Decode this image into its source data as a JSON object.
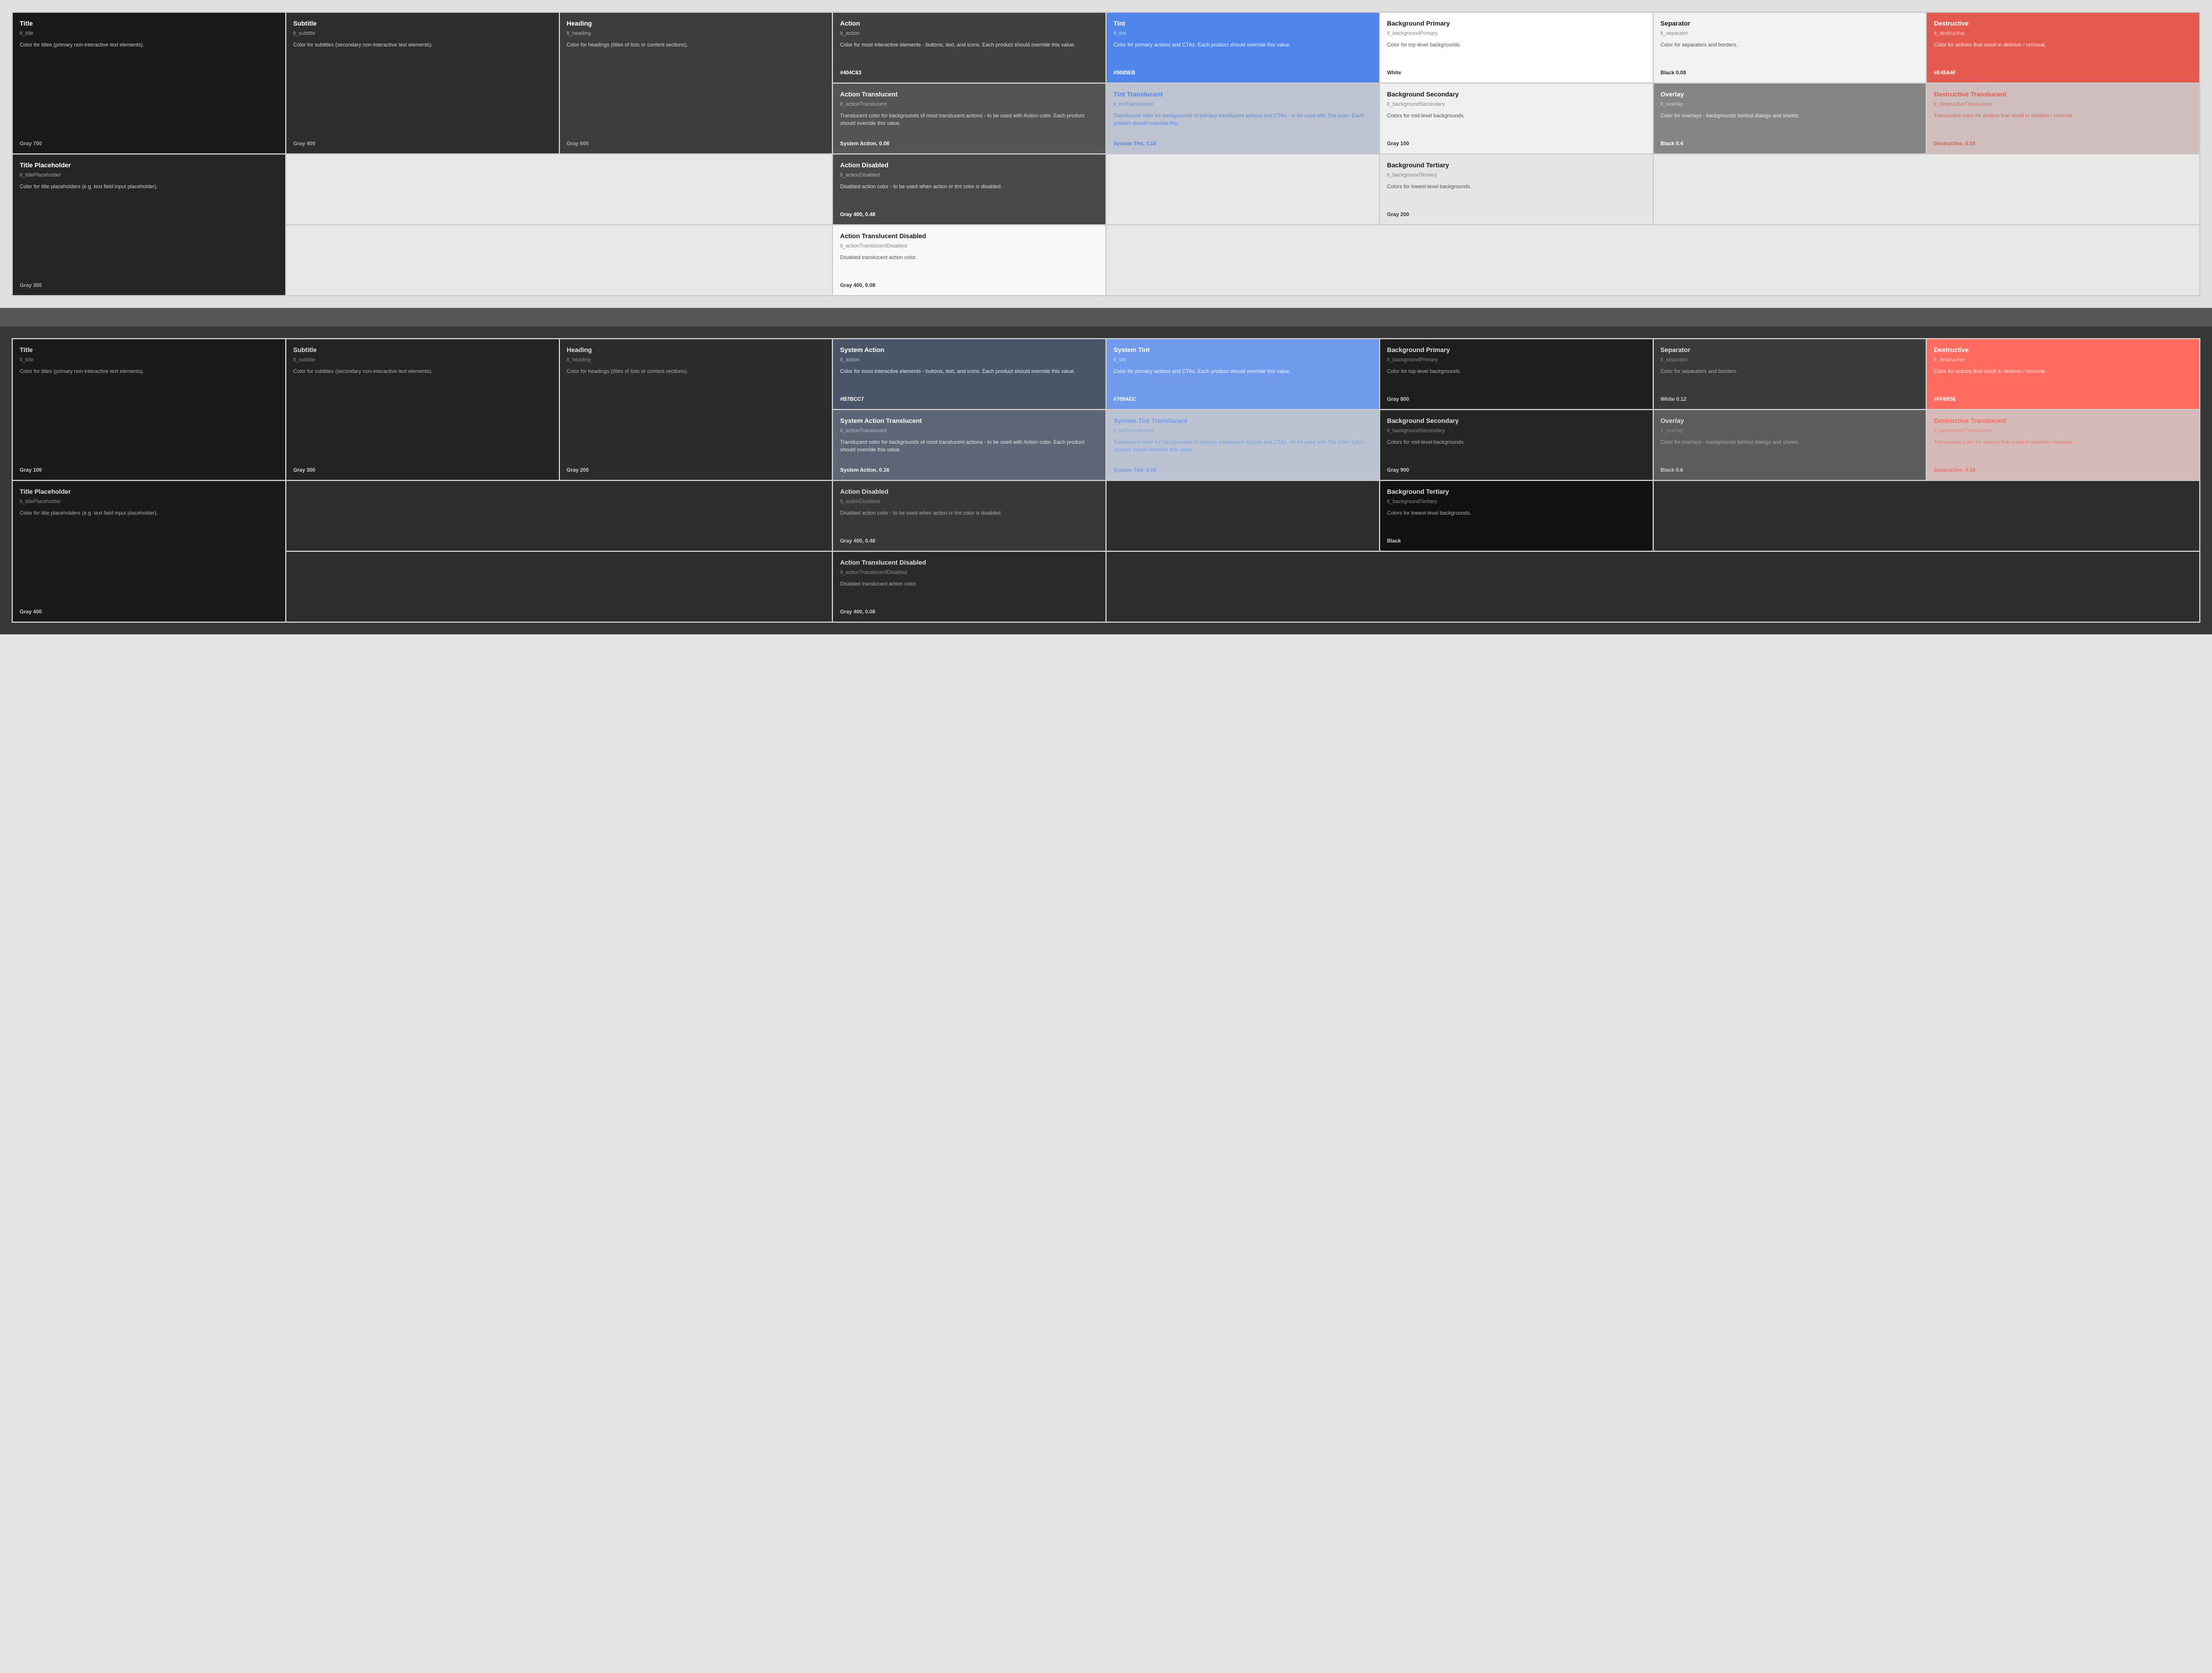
{
  "light": {
    "section_bg": "#e8e8e8",
    "cards": [
      {
        "id": "title",
        "title": "Title",
        "token": "lt_title",
        "desc": "Color for titles (primary non-interactive text elements).",
        "value": "Gray 700",
        "bg_class": "lt-title",
        "title_color": "#ffffff",
        "token_color": "rgba(255,255,255,0.6)",
        "desc_color": "rgba(255,255,255,0.75)",
        "value_color": "#cccccc"
      },
      {
        "id": "subtitle",
        "title": "Subtitle",
        "token": "lt_subtitle",
        "desc": "Color for subtitles (secondary non-interactive text elements).",
        "value": "Gray 400",
        "bg_class": "lt-subtitle",
        "title_color": "#ffffff",
        "token_color": "rgba(255,255,255,0.6)",
        "desc_color": "rgba(255,255,255,0.75)",
        "value_color": "#cccccc"
      },
      {
        "id": "heading",
        "title": "Heading",
        "token": "lt_heading",
        "desc": "Color for headings (titles of lists or content sections).",
        "value": "Gray 600",
        "bg_class": "lt-heading",
        "title_color": "#ffffff",
        "token_color": "rgba(255,255,255,0.6)",
        "desc_color": "rgba(255,255,255,0.75)",
        "value_color": "#cccccc"
      },
      {
        "id": "action",
        "title": "Action",
        "token": "lt_action",
        "desc": "Color for most interactive elements - buttons, text, and icons. Each product should override this value.",
        "value": "#404C63",
        "bg_class": "lt-action",
        "title_color": "#ffffff",
        "token_color": "rgba(255,255,255,0.6)",
        "desc_color": "rgba(255,255,255,0.8)",
        "value_color": "#ffffff"
      },
      {
        "id": "tint",
        "title": "Tint",
        "token": "lt_tint",
        "desc": "Color for primary actions and CTAs. Each product should override this value.",
        "value": "#5085EB",
        "bg_class": "lt-tint",
        "title_color": "#ffffff",
        "token_color": "rgba(255,255,255,0.7)",
        "desc_color": "rgba(255,255,255,0.9)",
        "value_color": "#ffffff"
      },
      {
        "id": "bg-primary",
        "title": "Background Primary",
        "token": "lt_backgroundPrimary",
        "desc": "Color for top-level backgrounds.",
        "value": "White",
        "bg_class": "lt-bg-primary",
        "title_color": "#1a1a1a",
        "token_color": "#888",
        "desc_color": "#555",
        "value_color": "#333"
      },
      {
        "id": "separator",
        "title": "Separator",
        "token": "lt_separator",
        "desc": "Color for separators and borders.",
        "value": "Black 0.08",
        "bg_class": "lt-separator",
        "title_color": "#1a1a1a",
        "token_color": "#888",
        "desc_color": "#555",
        "value_color": "#333"
      },
      {
        "id": "destructive",
        "title": "Destructive",
        "token": "lt_destructive",
        "desc": "Color for actions that result in deletion / removal.",
        "value": "#E45A4F",
        "bg_class": "lt-destructive",
        "title_color": "#ffffff",
        "token_color": "rgba(255,255,255,0.7)",
        "desc_color": "rgba(255,255,255,0.9)",
        "value_color": "#ffffff"
      },
      {
        "id": "title-placeholder",
        "title": "Title Placeholder",
        "token": "lt_titlePlaceholder",
        "desc": "Color for title placeholders (e.g. text field input placeholder).",
        "value": "Gray 300",
        "bg_class": "lt-title-ph",
        "title_color": "#ffffff",
        "token_color": "rgba(255,255,255,0.6)",
        "desc_color": "rgba(255,255,255,0.75)",
        "value_color": "#cccccc",
        "row_span": 2
      },
      {
        "id": "action-translucent",
        "title": "Action Translucent",
        "token": "lt_actionTranslucent",
        "desc": "Translucent color for backgrounds of most translucent actions - to be used with Action color. Each product should override this value.",
        "value": "System Action, 0.08",
        "bg_class": "lt-action",
        "title_color": "#ffffff",
        "token_color": "rgba(255,255,255,0.6)",
        "desc_color": "rgba(255,255,255,0.8)",
        "value_color": "#ffffff"
      },
      {
        "id": "tint-translucent",
        "title": "Tint Translucent",
        "token": "lt_tintTranslucent",
        "desc": "Translucent color for backgrounds of primary translucent actions and CTAs - to be used with Tint color. Each product should override this.",
        "value": "System Tint, 0.16",
        "bg_class": "lt-tint-trans",
        "title_color": "#5085EB",
        "token_color": "#5085EB",
        "desc_color": "#5085EB",
        "value_color": "#5085EB"
      },
      {
        "id": "bg-secondary",
        "title": "Background Secondary",
        "token": "lt_backgroundSecondary",
        "desc": "Colors for mid-level backgrounds.",
        "value": "Gray 100",
        "bg_class": "lt-bg-secondary",
        "title_color": "#1a1a1a",
        "token_color": "#888",
        "desc_color": "#555",
        "value_color": "#333"
      },
      {
        "id": "overlay",
        "title": "Overlay",
        "token": "lt_overlay",
        "desc": "Color for overlays - backgrounds behind dialogs and sheets.",
        "value": "Black 0.4",
        "bg_class": "lt-overlay",
        "title_color": "#ffffff",
        "token_color": "rgba(255,255,255,0.6)",
        "desc_color": "rgba(255,255,255,0.8)",
        "value_color": "#ffffff"
      },
      {
        "id": "destructive-translucent",
        "title": "Destructive Translucent",
        "token": "lt_destructiveTranslucent",
        "desc": "Translucent color for actions that result in deletion / removal.",
        "value": "Destructive, 0.16",
        "bg_class": "lt-destructive-trans",
        "title_color": "#E45A4F",
        "token_color": "#E45A4F",
        "desc_color": "#E45A4F",
        "value_color": "#E45A4F"
      },
      {
        "id": "action-disabled",
        "title": "Action Disabled",
        "token": "lt_actionDisabled",
        "desc": "Disabled action color - to be used when action or tint color is disabled.",
        "value": "Gray 400, 0.48",
        "bg_class": "lt-action-disabled",
        "title_color": "#ffffff",
        "token_color": "rgba(255,255,255,0.6)",
        "desc_color": "rgba(255,255,255,0.8)",
        "value_color": "#ffffff"
      },
      {
        "id": "bg-tertiary",
        "title": "Background Tertiary",
        "token": "lt_backgroundTertiary",
        "desc": "Colors for lowest-level backgrounds.",
        "value": "Gray 200",
        "bg_class": "lt-bg-tertiary",
        "title_color": "#1a1a1a",
        "token_color": "#888",
        "desc_color": "#555",
        "value_color": "#333"
      },
      {
        "id": "action-trans-disabled",
        "title": "Action Translucent Disabled",
        "token": "lt_actionTranslucentDisabled",
        "desc": "Disabled translucent action color.",
        "value": "Gray 400, 0.08",
        "bg_class": "lt-action-trans-disabled",
        "title_color": "#1a1a1a",
        "token_color": "#888",
        "desc_color": "#555",
        "value_color": "#333"
      }
    ]
  },
  "dark": {
    "section_bg": "#2a2a2a",
    "cards": [
      {
        "id": "dk-title",
        "title": "Title",
        "token": "lt_title",
        "desc": "Color for titles (primary non-interactive text elements).",
        "value": "Gray 100",
        "bg_class": "dk-title",
        "title_color": "#dddddd",
        "token_color": "#888888",
        "desc_color": "#aaaaaa",
        "value_color": "#cccccc"
      },
      {
        "id": "dk-subtitle",
        "title": "Subtitle",
        "token": "lt_subtitle",
        "desc": "Color for subtitles (secondary non-interactive text elements).",
        "value": "Gray 300",
        "bg_class": "dk-subtitle",
        "title_color": "#dddddd",
        "token_color": "#888888",
        "desc_color": "#aaaaaa",
        "value_color": "#cccccc"
      },
      {
        "id": "dk-heading",
        "title": "Heading",
        "token": "lt_heading",
        "desc": "Color for headings (titles of lists or content sections).",
        "value": "Gray 200",
        "bg_class": "dk-heading",
        "title_color": "#dddddd",
        "token_color": "#888888",
        "desc_color": "#aaaaaa",
        "value_color": "#cccccc"
      },
      {
        "id": "dk-system-action",
        "title": "System Action",
        "token": "lt_action",
        "desc": "Color for most interactive elements - buttons, text, and icons. Each product should override this value.",
        "value": "#B7BCC7",
        "bg_class": "dk-system-action",
        "title_color": "#ffffff",
        "token_color": "rgba(255,255,255,0.6)",
        "desc_color": "rgba(255,255,255,0.85)",
        "value_color": "#ffffff"
      },
      {
        "id": "dk-system-tint",
        "title": "System Tint",
        "token": "lt_tint",
        "desc": "Color for primary actions and CTAs. Each product should override this value.",
        "value": "#709AEC",
        "bg_class": "dk-system-tint",
        "title_color": "#ffffff",
        "token_color": "rgba(255,255,255,0.7)",
        "desc_color": "rgba(255,255,255,0.9)",
        "value_color": "#ffffff"
      },
      {
        "id": "dk-bg-primary",
        "title": "Background Primary",
        "token": "lt_backgroundPrimary",
        "desc": "Color for top-level backgrounds.",
        "value": "Gray 800",
        "bg_class": "dk-bg-primary",
        "title_color": "#dddddd",
        "token_color": "#888888",
        "desc_color": "#aaaaaa",
        "value_color": "#cccccc"
      },
      {
        "id": "dk-separator",
        "title": "Separator",
        "token": "lt_separator",
        "desc": "Color for separators and borders.",
        "value": "White 0.12",
        "bg_class": "dk-separator",
        "title_color": "#dddddd",
        "token_color": "#888888",
        "desc_color": "#aaaaaa",
        "value_color": "#cccccc"
      },
      {
        "id": "dk-destructive",
        "title": "Destructive",
        "token": "lt_destructive",
        "desc": "Color for actions that result in deletion / removal.",
        "value": "#FF6B5E",
        "bg_class": "dk-destructive",
        "title_color": "#ffffff",
        "token_color": "rgba(255,255,255,0.7)",
        "desc_color": "rgba(255,255,255,0.9)",
        "value_color": "#ffffff"
      },
      {
        "id": "dk-title-ph",
        "title": "Title Placeholder",
        "token": "lt_titlePlaceholder",
        "desc": "Color for title placeholders (e.g. text field input placeholder).",
        "value": "Gray 400",
        "bg_class": "dk-title-ph",
        "title_color": "#dddddd",
        "token_color": "#888888",
        "desc_color": "#aaaaaa",
        "value_color": "#cccccc",
        "row_span": 2
      },
      {
        "id": "dk-system-action-trans",
        "title": "System Action Translucent",
        "token": "lt_actionTranslucent",
        "desc": "Translucent color for backgrounds of most translucent actions - to be used with Action color. Each product should override this value.",
        "value": "System Action, 0.16",
        "bg_class": "dk-system-action",
        "title_color": "#ffffff",
        "token_color": "rgba(255,255,255,0.6)",
        "desc_color": "rgba(255,255,255,0.85)",
        "value_color": "#ffffff"
      },
      {
        "id": "dk-system-tint-trans",
        "title": "System Tint Translucent",
        "token": "lt_tintTranslucent",
        "desc": "Translucent color for backgrounds of primary translucent actions and CTAs - to be used with Tint color. Each product should override this value.",
        "value": "System Tint, 0.16",
        "bg_class": "dk-system-tint-trans",
        "title_color": "#709AEC",
        "token_color": "#709AEC",
        "desc_color": "#709AEC",
        "value_color": "#709AEC"
      },
      {
        "id": "dk-bg-secondary",
        "title": "Background Secondary",
        "token": "lt_backgroundSecondary",
        "desc": "Colors for mid-level backgrounds.",
        "value": "Gray 900",
        "bg_class": "dk-bg-secondary",
        "title_color": "#dddddd",
        "token_color": "#888888",
        "desc_color": "#aaaaaa",
        "value_color": "#cccccc"
      },
      {
        "id": "dk-overlay",
        "title": "Overlay",
        "token": "lt_overlay",
        "desc": "Color for overlays - backgrounds behind dialogs and sheets.",
        "value": "Black 0.6",
        "bg_class": "dk-overlay",
        "title_color": "#dddddd",
        "token_color": "#888888",
        "desc_color": "#aaaaaa",
        "value_color": "#cccccc"
      },
      {
        "id": "dk-destructive-trans",
        "title": "Destructive Translucent",
        "token": "lt_destructiveTranslucent",
        "desc": "Translucent color for actions that result in deletion / removal.",
        "value": "Destructive, 0.16",
        "bg_class": "dk-destructive-trans",
        "title_color": "#FF6B5E",
        "token_color": "#FF6B5E",
        "desc_color": "#FF6B5E",
        "value_color": "#FF6B5E"
      },
      {
        "id": "dk-action-disabled",
        "title": "Action Disabled",
        "token": "lt_actionDisabled",
        "desc": "Disabled action color - to be used when action or tint color is disabled.",
        "value": "Gray 400, 0.48",
        "bg_class": "dk-action-disabled",
        "title_color": "#dddddd",
        "token_color": "#888888",
        "desc_color": "#aaaaaa",
        "value_color": "#cccccc"
      },
      {
        "id": "dk-bg-tertiary",
        "title": "Background Tertiary",
        "token": "lt_backgroundTertiary",
        "desc": "Colors for lowest-level backgrounds.",
        "value": "Black",
        "bg_class": "dk-bg-tertiary",
        "title_color": "#dddddd",
        "token_color": "#888888",
        "desc_color": "#aaaaaa",
        "value_color": "#cccccc"
      },
      {
        "id": "dk-action-trans-disabled",
        "title": "Action Translucent Disabled",
        "token": "lt_actionTranslucentDisabled",
        "desc": "Disabled translucent action color.",
        "value": "Gray 400, 0.08",
        "bg_class": "dk-action-trans-disabled",
        "title_color": "#dddddd",
        "token_color": "#888888",
        "desc_color": "#aaaaaa",
        "value_color": "#cccccc"
      }
    ]
  }
}
